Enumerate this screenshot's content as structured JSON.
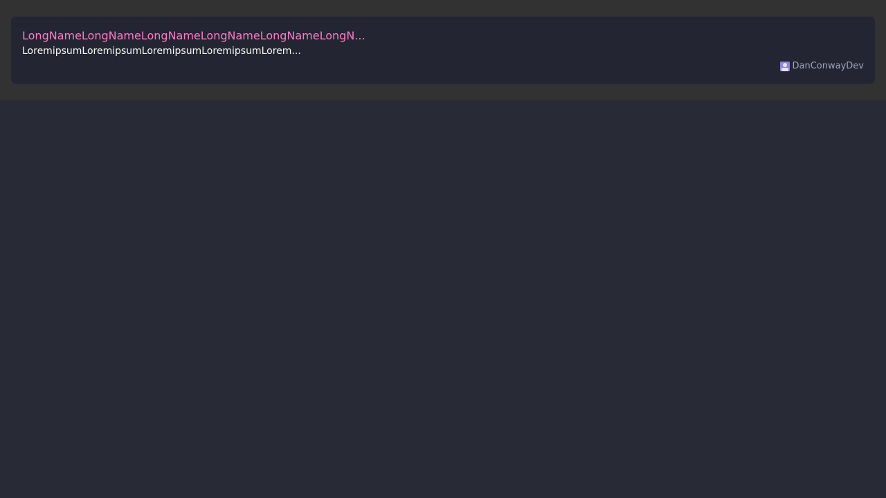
{
  "card": {
    "title": "LongNameLongNameLongNameLongNameLongNameLongN...",
    "description": "LoremipsumLoremipsumLoremipsumLoremipsumLorem...",
    "author": {
      "name": "DanConwayDev",
      "avatar_icon": "user-avatar-icon"
    }
  },
  "colors": {
    "page_background": "#282a36",
    "top_band": "#323232",
    "card_background": "#232532",
    "title": "#ff79c6",
    "description": "#f8f8f2",
    "author": "#9ea3bd",
    "avatar": "#bd93f9"
  }
}
